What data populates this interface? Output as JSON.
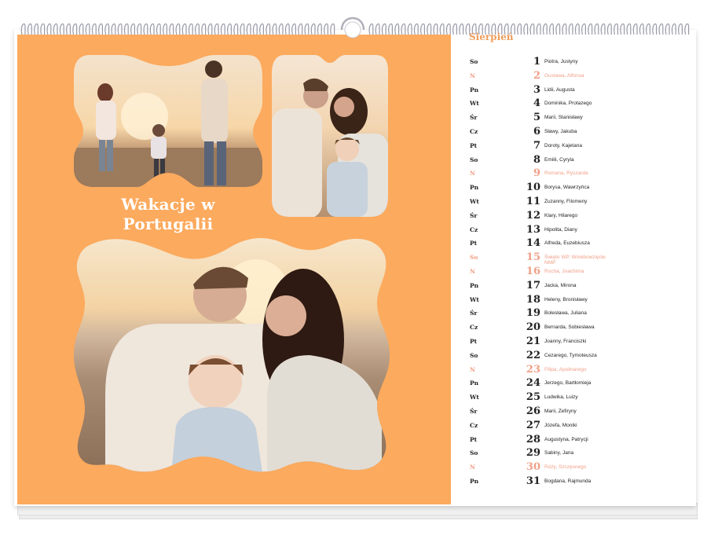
{
  "colors": {
    "panel": "#fcaa5e",
    "holiday": "#f0a088",
    "month": "#f09c5a",
    "text": "#222222"
  },
  "title_lines": [
    "Wakacje w",
    "Portugalii"
  ],
  "month": "Sierpień",
  "days": [
    {
      "weekday": "So",
      "num": "1",
      "names": "Piotra, Justyny",
      "holiday": false
    },
    {
      "weekday": "N",
      "num": "2",
      "names": "Gustawa, Alfonsa",
      "holiday": true
    },
    {
      "weekday": "Pn",
      "num": "3",
      "names": "Lidii, Augusta",
      "holiday": false
    },
    {
      "weekday": "Wt",
      "num": "4",
      "names": "Dominika, Protazego",
      "holiday": false
    },
    {
      "weekday": "Śr",
      "num": "5",
      "names": "Marii, Stanisławy",
      "holiday": false
    },
    {
      "weekday": "Cz",
      "num": "6",
      "names": "Sławy, Jakuba",
      "holiday": false
    },
    {
      "weekday": "Pt",
      "num": "7",
      "names": "Doroty, Kajetana",
      "holiday": false
    },
    {
      "weekday": "So",
      "num": "8",
      "names": "Emilii, Cyryla",
      "holiday": false
    },
    {
      "weekday": "N",
      "num": "9",
      "names": "Romana, Ryszarda",
      "holiday": true
    },
    {
      "weekday": "Pn",
      "num": "10",
      "names": "Borysa, Wawrzyńca",
      "holiday": false
    },
    {
      "weekday": "Wt",
      "num": "11",
      "names": "Zuzanny, Filomeny",
      "holiday": false
    },
    {
      "weekday": "Śr",
      "num": "12",
      "names": "Klary, Hilarego",
      "holiday": false
    },
    {
      "weekday": "Cz",
      "num": "13",
      "names": "Hipolita, Diany",
      "holiday": false
    },
    {
      "weekday": "Pt",
      "num": "14",
      "names": "Alfreda, Euzebiusza",
      "holiday": false
    },
    {
      "weekday": "So",
      "num": "15",
      "names": "Święto WP, Wniebowzięcie NMP",
      "holiday": true
    },
    {
      "weekday": "N",
      "num": "16",
      "names": "Rocha, Joachima",
      "holiday": true
    },
    {
      "weekday": "Pn",
      "num": "17",
      "names": "Jacka, Mirona",
      "holiday": false
    },
    {
      "weekday": "Wt",
      "num": "18",
      "names": "Heleny, Bronisławy",
      "holiday": false
    },
    {
      "weekday": "Śr",
      "num": "19",
      "names": "Bolesława, Juliana",
      "holiday": false
    },
    {
      "weekday": "Cz",
      "num": "20",
      "names": "Bernarda, Sobiesława",
      "holiday": false
    },
    {
      "weekday": "Pt",
      "num": "21",
      "names": "Joanny, Franciszki",
      "holiday": false
    },
    {
      "weekday": "So",
      "num": "22",
      "names": "Cezarego, Tymoteusza",
      "holiday": false
    },
    {
      "weekday": "N",
      "num": "23",
      "names": "Filipa, Apolinarego",
      "holiday": true
    },
    {
      "weekday": "Pn",
      "num": "24",
      "names": "Jerzego, Bartłomieja",
      "holiday": false
    },
    {
      "weekday": "Wt",
      "num": "25",
      "names": "Ludwika, Luizy",
      "holiday": false
    },
    {
      "weekday": "Śr",
      "num": "26",
      "names": "Marii, Zefiryny",
      "holiday": false
    },
    {
      "weekday": "Cz",
      "num": "27",
      "names": "Józefa, Moniki",
      "holiday": false
    },
    {
      "weekday": "Pt",
      "num": "28",
      "names": "Augustyna, Patrycji",
      "holiday": false
    },
    {
      "weekday": "So",
      "num": "29",
      "names": "Sabiny, Jana",
      "holiday": false
    },
    {
      "weekday": "N",
      "num": "30",
      "names": "Róży, Szczęsnego",
      "holiday": true
    },
    {
      "weekday": "Pn",
      "num": "31",
      "names": "Bogdana, Rajmunda",
      "holiday": false
    }
  ]
}
